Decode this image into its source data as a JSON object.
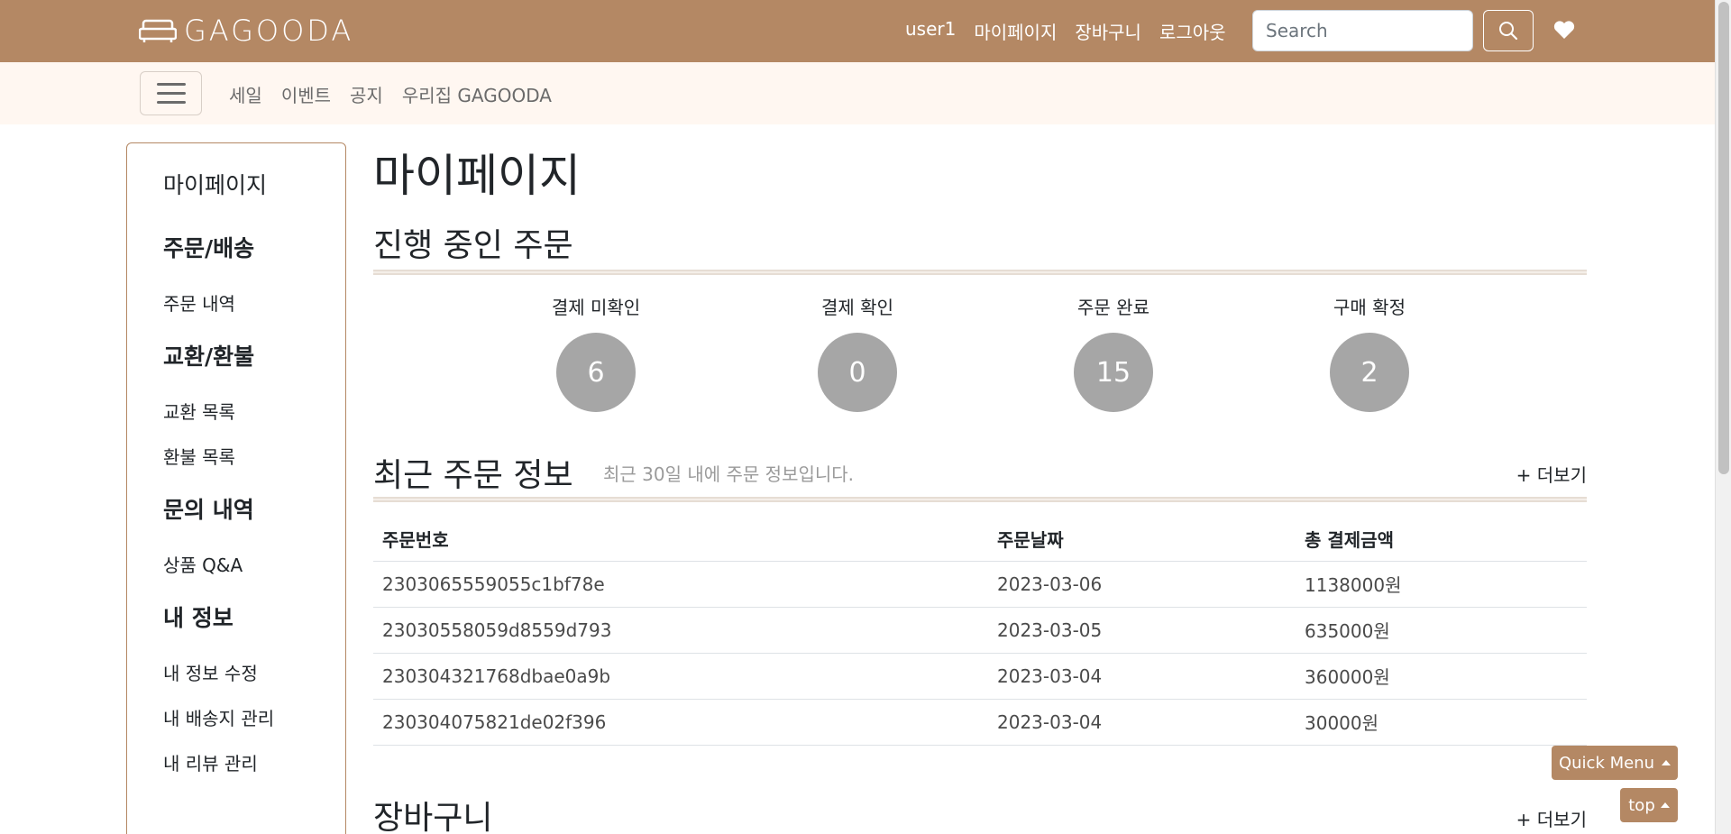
{
  "brand": {
    "name": "GAGOODA"
  },
  "top_nav": {
    "links": [
      "user1",
      "마이페이지",
      "장바구니",
      "로그아웃"
    ],
    "search_placeholder": "Search"
  },
  "sub_nav": {
    "links": [
      "세일",
      "이벤트",
      "공지",
      "우리집 GAGOODA"
    ]
  },
  "sidebar": {
    "title": "마이페이지",
    "sections": [
      {
        "heading": "주문/배송",
        "items": [
          "주문 내역"
        ]
      },
      {
        "heading": "교환/환불",
        "items": [
          "교환 목록",
          "환불 목록"
        ]
      },
      {
        "heading": "문의 내역",
        "items": [
          "상품 Q&A"
        ]
      },
      {
        "heading": "내 정보",
        "items": [
          "내 정보 수정",
          "내 배송지 관리",
          "내 리뷰 관리"
        ]
      }
    ]
  },
  "main": {
    "page_title": "마이페이지",
    "in_progress": {
      "title": "진행 중인 주문",
      "statuses": [
        {
          "label": "결제 미확인",
          "count": "6"
        },
        {
          "label": "결제 확인",
          "count": "0"
        },
        {
          "label": "주문 완료",
          "count": "15"
        },
        {
          "label": "구매 확정",
          "count": "2"
        }
      ]
    },
    "recent_orders": {
      "title": "최근 주문 정보",
      "subtitle": "최근 30일 내에 주문 정보입니다.",
      "more": "+ 더보기",
      "columns": [
        "주문번호",
        "주문날짜",
        "총 결제금액"
      ],
      "rows": [
        [
          "2303065559055c1bf78e",
          "2023-03-06",
          "1138000원"
        ],
        [
          "23030558059d8559d793",
          "2023-03-05",
          "635000원"
        ],
        [
          "230304321768dbae0a9b",
          "2023-03-04",
          "360000원"
        ],
        [
          "230304075821de02f396",
          "2023-03-04",
          "30000원"
        ]
      ]
    },
    "cart": {
      "title": "장바구니",
      "more": "+ 더보기"
    }
  },
  "floating": {
    "quick_menu": "Quick Menu",
    "top": "top"
  },
  "colors": {
    "brand_brown": "#b48864",
    "subnav_bg": "#fff7f1",
    "status_circle": "#a6a6a6"
  }
}
